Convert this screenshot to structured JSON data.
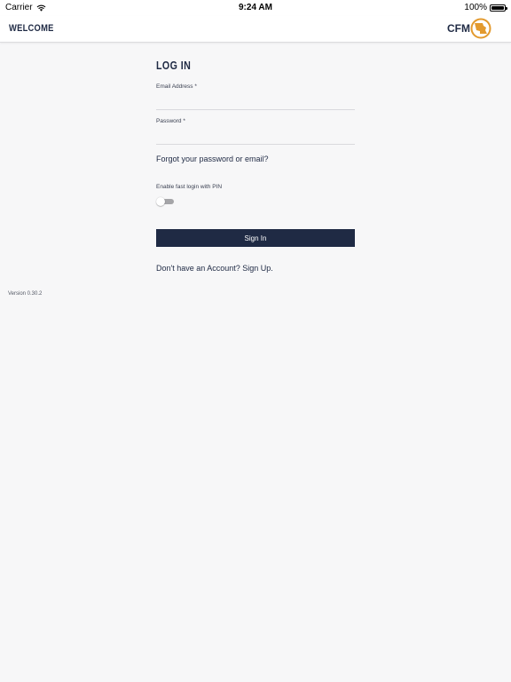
{
  "status_bar": {
    "carrier": "Carrier",
    "time": "9:24 AM",
    "battery": "100%"
  },
  "nav": {
    "title": "WELCOME",
    "logo_text": "CFM"
  },
  "login": {
    "heading": "LOG IN",
    "email_label": "Email Address *",
    "email_value": "",
    "password_label": "Password *",
    "password_value": "",
    "forgot_link": "Forgot your password or email?",
    "pin_label": "Enable fast login with PIN",
    "pin_enabled": false,
    "sign_in_button": "Sign In",
    "signup_link": "Don't have an Account? Sign Up."
  },
  "version": "Version 0.30.2",
  "colors": {
    "primary": "#1f2a44",
    "accent": "#e39a2e",
    "background": "#f7f7f8"
  }
}
